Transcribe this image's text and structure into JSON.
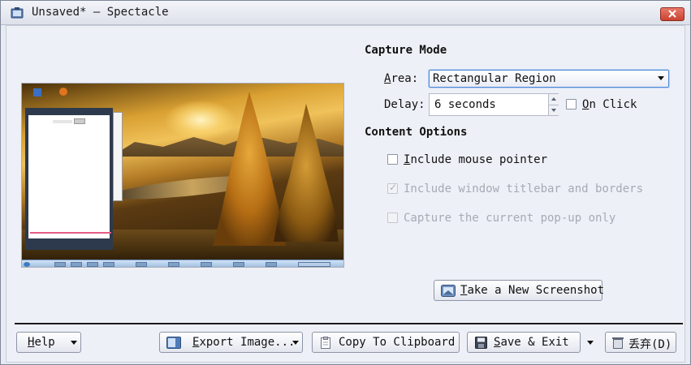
{
  "window": {
    "title": "Unsaved* — Spectacle"
  },
  "capture_mode": {
    "heading": "Capture Mode",
    "area_label": "Area:",
    "area_value": "Rectangular Region",
    "delay_label": "Delay:",
    "delay_value": "6 seconds",
    "on_click_label": "On Click"
  },
  "content_options": {
    "heading": "Content Options",
    "include_mouse_pointer": "Include mouse pointer",
    "include_titlebar": "Include window titlebar and borders",
    "capture_popup": "Capture the current pop-up only"
  },
  "buttons": {
    "take_screenshot": "Take a New Screenshot",
    "help": "Help",
    "export": "Export Image...",
    "copy": "Copy To Clipboard",
    "save_exit": "Save & Exit",
    "discard": "丢弃(D)"
  },
  "states": {
    "on_click_checked": false,
    "include_mouse_pointer_checked": false,
    "include_titlebar_checked": true,
    "include_titlebar_enabled": false,
    "capture_popup_checked": false,
    "capture_popup_enabled": false
  },
  "colors": {
    "accent_border": "#4e89d6",
    "window_bg": "#eef0f7",
    "close_button": "#c9432f"
  },
  "icons": {
    "app": "spectacle-icon",
    "close": "close-icon",
    "take": "camera-icon",
    "export": "export-icon",
    "copy": "clipboard-icon",
    "save": "floppy-icon",
    "discard": "trash-icon"
  }
}
